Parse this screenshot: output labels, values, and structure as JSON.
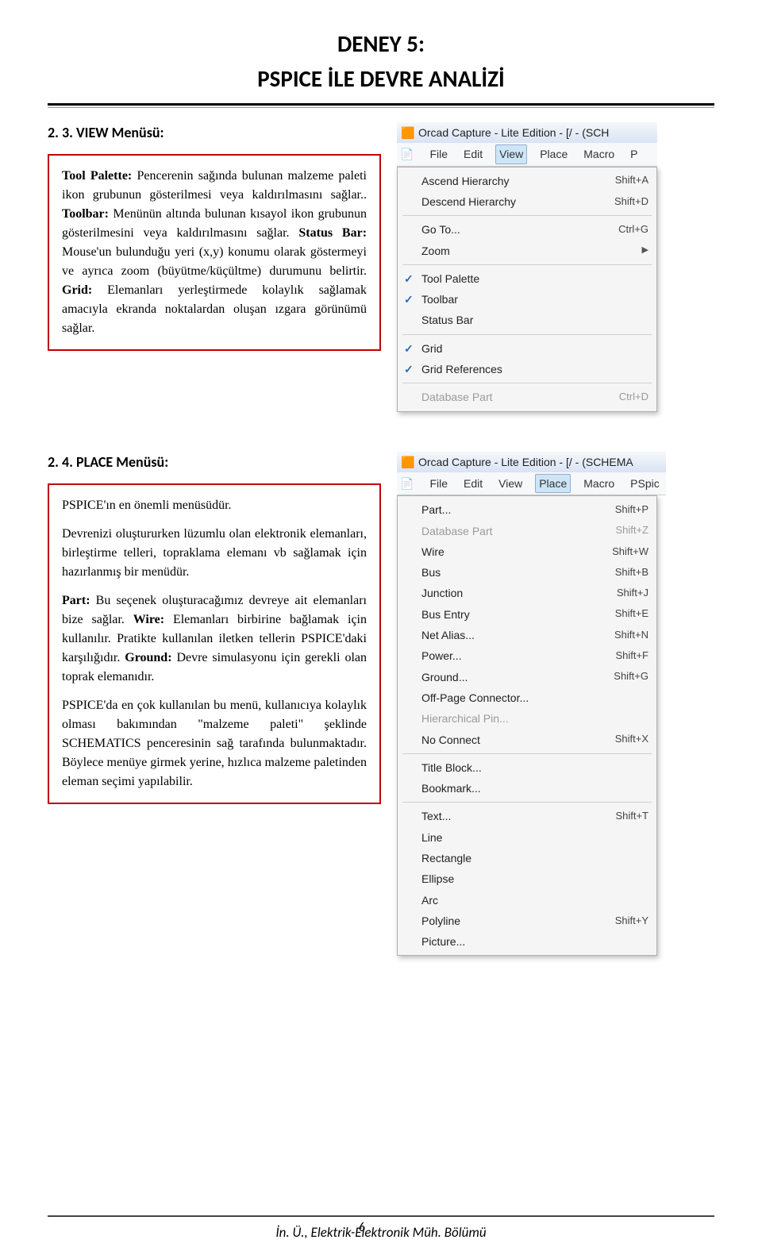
{
  "doc": {
    "title": "DENEY 5:",
    "subtitle": "PSPICE İLE DEVRE ANALİZİ",
    "footer": "İn. Ü., Elektrik-Elektronik Müh. Bölümü",
    "page_num": "6"
  },
  "section_view": {
    "heading": "2. 3. VIEW Menüsü:",
    "p1_b": "Tool Palette:",
    "p1": " Pencerenin sağında bulunan malzeme paleti ikon grubunun gösterilmesi veya kaldırılmasını sağlar..",
    "p2_b": "Toolbar:",
    "p2": " Menünün altında bulunan kısayol ikon grubunun gösterilmesini veya kaldırılmasını sağlar.",
    "p3_b": "Status Bar:",
    "p3": " Mouse'un bulunduğu yeri (x,y) konumu olarak göstermeyi ve ayrıca zoom (büyütme/küçültme) durumunu belirtir.",
    "p4_b": "Grid:",
    "p4": " Elemanları yerleştirmede kolaylık sağlamak amacıyla ekranda noktalardan oluşan ızgara görünümü sağlar."
  },
  "section_place": {
    "heading": "2. 4. PLACE Menüsü:",
    "p1": "PSPICE'ın en önemli menüsüdür.",
    "p2": "Devrenizi oluştururken lüzumlu olan elektronik elemanları, birleştirme telleri, topraklama elemanı vb sağlamak için hazırlanmış bir menüdür.",
    "p3_b1": "Part:",
    "p3_t1": " Bu seçenek oluşturacağımız devreye ait elemanları bize sağlar. ",
    "p3_b2": "Wire:",
    "p3_t2": " Elemanları birbirine bağlamak için kullanılır. Pratikte kullanılan iletken tellerin PSPICE'daki karşılığıdır. ",
    "p3_b3": "Ground:",
    "p3_t3": " Devre simulasyonu için gerekli olan toprak elemanıdır.",
    "p4": "PSPICE'da en çok kullanılan bu menü, kullanıcıya kolaylık olması bakımından \"malzeme paleti\" şeklinde SCHEMATICS penceresinin sağ tarafında bulunmaktadır. Böylece menüye girmek yerine, hızlıca malzeme paletinden eleman seçimi yapılabilir."
  },
  "view_shot": {
    "title": "Orcad Capture - Lite Edition - [/ - (SCH",
    "menubar": [
      "File",
      "Edit",
      "View",
      "Place",
      "Macro",
      "P"
    ],
    "open_index": 2,
    "items": [
      {
        "label": "Ascend Hierarchy",
        "sc": "Shift+A"
      },
      {
        "label": "Descend Hierarchy",
        "sc": "Shift+D"
      },
      {
        "sep": true
      },
      {
        "label": "Go To...",
        "sc": "Ctrl+G"
      },
      {
        "label": "Zoom",
        "sub": true
      },
      {
        "sep": true
      },
      {
        "label": "Tool Palette",
        "check": true
      },
      {
        "label": "Toolbar",
        "check": true
      },
      {
        "label": "Status Bar"
      },
      {
        "sep": true
      },
      {
        "label": "Grid",
        "check": true
      },
      {
        "label": "Grid References",
        "check": true
      },
      {
        "sep": true
      },
      {
        "label": "Database Part",
        "sc": "Ctrl+D",
        "disabled": true
      }
    ]
  },
  "place_shot": {
    "title": "Orcad Capture - Lite Edition - [/ - (SCHEMA",
    "menubar": [
      "File",
      "Edit",
      "View",
      "Place",
      "Macro",
      "PSpic"
    ],
    "open_index": 3,
    "items": [
      {
        "label": "Part...",
        "sc": "Shift+P"
      },
      {
        "label": "Database Part",
        "sc": "Shift+Z",
        "disabled": true
      },
      {
        "label": "Wire",
        "sc": "Shift+W"
      },
      {
        "label": "Bus",
        "sc": "Shift+B"
      },
      {
        "label": "Junction",
        "sc": "Shift+J"
      },
      {
        "label": "Bus Entry",
        "sc": "Shift+E"
      },
      {
        "label": "Net Alias...",
        "sc": "Shift+N"
      },
      {
        "label": "Power...",
        "sc": "Shift+F"
      },
      {
        "label": "Ground...",
        "sc": "Shift+G"
      },
      {
        "label": "Off-Page Connector..."
      },
      {
        "label": "Hierarchical Pin...",
        "disabled": true
      },
      {
        "label": "No Connect",
        "sc": "Shift+X"
      },
      {
        "sep": true
      },
      {
        "label": "Title Block..."
      },
      {
        "label": "Bookmark..."
      },
      {
        "sep": true
      },
      {
        "label": "Text...",
        "sc": "Shift+T"
      },
      {
        "label": "Line"
      },
      {
        "label": "Rectangle"
      },
      {
        "label": "Ellipse"
      },
      {
        "label": "Arc"
      },
      {
        "label": "Polyline",
        "sc": "Shift+Y"
      },
      {
        "label": "Picture..."
      }
    ]
  }
}
